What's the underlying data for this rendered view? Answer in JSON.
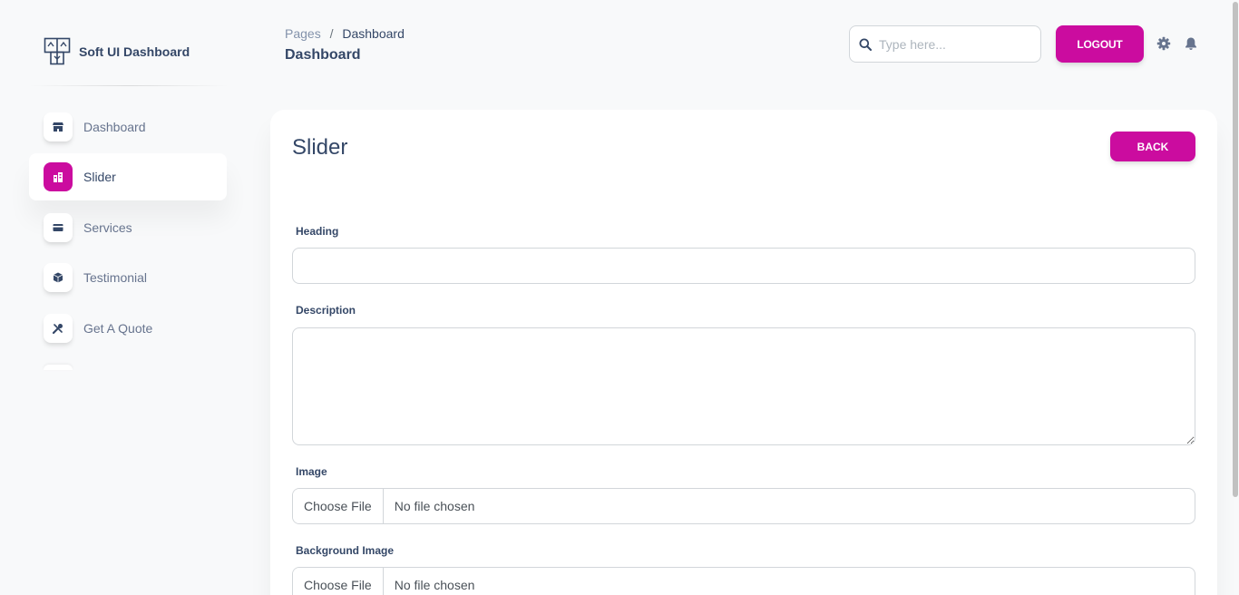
{
  "app": {
    "brand_name": "Soft UI Dashboard",
    "accent_color": "#cb0c9f"
  },
  "sidebar": {
    "items": [
      {
        "label": "Dashboard",
        "icon": "shop-icon",
        "active": false
      },
      {
        "label": "Slider",
        "icon": "office-icon",
        "active": true
      },
      {
        "label": "Services",
        "icon": "credit-card-icon",
        "active": false
      },
      {
        "label": "Testimonial",
        "icon": "box-3d-icon",
        "active": false
      },
      {
        "label": "Get A Quote",
        "icon": "tools-icon",
        "active": false
      }
    ]
  },
  "header": {
    "breadcrumb": {
      "parent": "Pages",
      "separator": "/",
      "current": "Dashboard"
    },
    "title": "Dashboard",
    "search": {
      "placeholder": "Type here...",
      "value": ""
    },
    "logout_label": "LOGOUT",
    "icons": [
      "gear-icon",
      "bell-icon"
    ]
  },
  "card": {
    "title": "Slider",
    "back_label": "BACK",
    "fields": {
      "heading": {
        "label": "Heading",
        "value": ""
      },
      "description": {
        "label": "Description",
        "value": ""
      },
      "image": {
        "label": "Image",
        "button": "Choose File",
        "status": "No file chosen"
      },
      "background_image": {
        "label": "Background Image",
        "button": "Choose File",
        "status": "No file chosen"
      }
    }
  }
}
